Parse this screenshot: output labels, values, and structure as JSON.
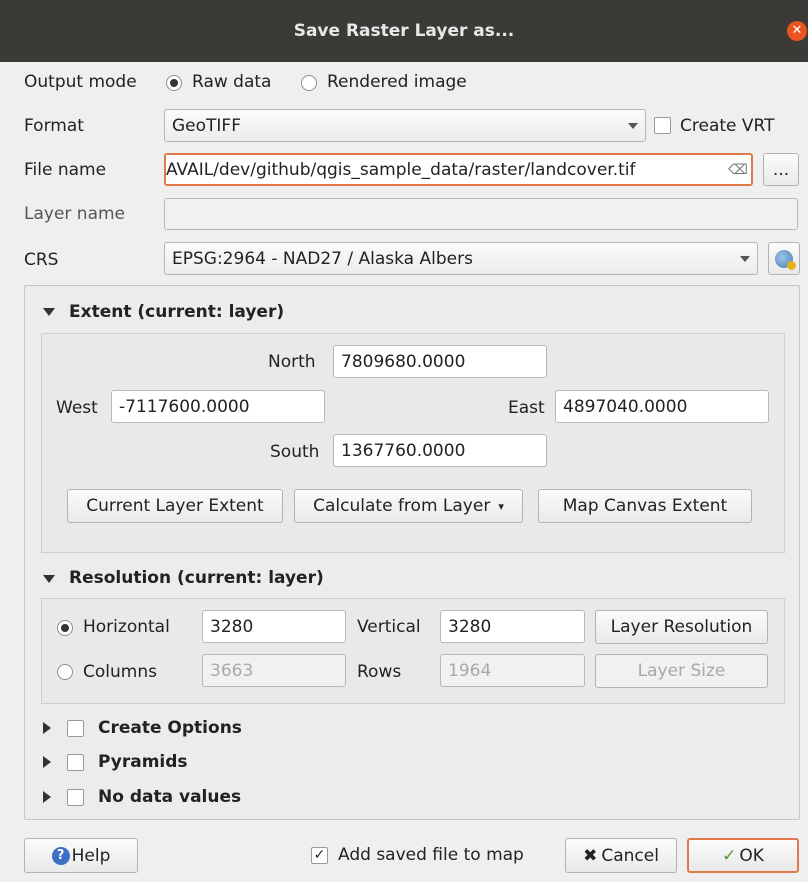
{
  "window": {
    "title": "Save Raster Layer as..."
  },
  "output_mode": {
    "label": "Output mode",
    "raw": "Raw data",
    "rendered": "Rendered image",
    "selected": "Raw data"
  },
  "format": {
    "label": "Format",
    "value": "GeoTIFF",
    "create_vrt": "Create VRT",
    "create_vrt_checked": false
  },
  "file_name": {
    "label": "File name",
    "value": "AVAIL/dev/github/qgis_sample_data/raster/landcover.tif",
    "browse": "..."
  },
  "layer_name": {
    "label": "Layer name",
    "value": ""
  },
  "crs": {
    "label": "CRS",
    "value": "EPSG:2964 - NAD27 / Alaska Albers"
  },
  "extent": {
    "title": "Extent (current: layer)",
    "north_label": "North",
    "north": "7809680.0000",
    "west_label": "West",
    "west": "-7117600.0000",
    "east_label": "East",
    "east": "4897040.0000",
    "south_label": "South",
    "south": "1367760.0000",
    "current_layer_btn": "Current Layer Extent",
    "calc_from_layer_btn": "Calculate from Layer",
    "map_canvas_btn": "Map Canvas Extent"
  },
  "resolution": {
    "title": "Resolution (current: layer)",
    "horizontal_label": "Horizontal",
    "horizontal": "3280",
    "vertical_label": "Vertical",
    "vertical": "3280",
    "layer_resolution_btn": "Layer Resolution",
    "columns_label": "Columns",
    "columns": "3663",
    "rows_label": "Rows",
    "rows": "1964",
    "layer_size_btn": "Layer Size",
    "selected": "Horizontal"
  },
  "sections": {
    "create_options": "Create Options",
    "pyramids": "Pyramids",
    "no_data": "No data values"
  },
  "footer": {
    "help": "Help",
    "add_to_map": "Add saved file to map",
    "add_to_map_checked": true,
    "cancel": "Cancel",
    "ok": "OK"
  }
}
